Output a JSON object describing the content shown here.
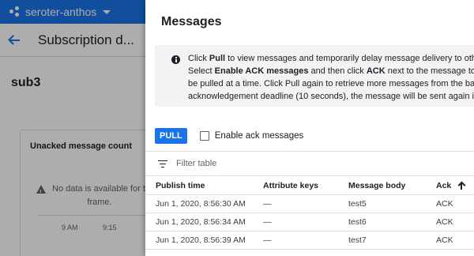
{
  "background": {
    "project_name": "seroter-anthos",
    "page_title": "Subscription d...",
    "subscription_name": "sub3",
    "chart": {
      "title": "Unacked message count",
      "no_data_line1": "No data is available for th",
      "no_data_line2": "frame.",
      "ticks": [
        "9 AM",
        "9:15"
      ]
    }
  },
  "panel": {
    "title": "Messages",
    "info_lines": [
      {
        "pre": "Click ",
        "b1": "Pull",
        "mid": " to view messages and temporarily delay message delivery to other su",
        "b2": "",
        "post": ""
      },
      {
        "pre": "Select ",
        "b1": "Enable ACK messages",
        "mid": " and then click ",
        "b2": "ACK",
        "post": " next to the message to perma"
      },
      {
        "pre": "be pulled at a time. Click Pull again to retrieve more messages from the backlog",
        "b1": "",
        "mid": "",
        "b2": "",
        "post": ""
      },
      {
        "pre": "acknowledgement deadline (10 seconds), the message will be sent again if no",
        "b1": "",
        "mid": "",
        "b2": "",
        "post": ""
      }
    ],
    "pull_label": "PULL",
    "enable_ack_label": "Enable ack messages",
    "enable_ack_checked": false,
    "filter_placeholder": "Filter table",
    "columns": [
      "Publish time",
      "Attribute keys",
      "Message body",
      "Ack"
    ],
    "rows": [
      {
        "publish_time": "Jun 1, 2020, 8:56:30 AM",
        "attribute_keys": "—",
        "message_body": "test5",
        "ack": "ACK"
      },
      {
        "publish_time": "Jun 1, 2020, 8:56:34 AM",
        "attribute_keys": "—",
        "message_body": "test6",
        "ack": "ACK"
      },
      {
        "publish_time": "Jun 1, 2020, 8:56:39 AM",
        "attribute_keys": "—",
        "message_body": "test7",
        "ack": "ACK"
      }
    ]
  },
  "colors": {
    "accent": "#1a73e8",
    "scrim": "rgba(0,0,0,0.32)",
    "info_bg": "#f1f3f4"
  }
}
